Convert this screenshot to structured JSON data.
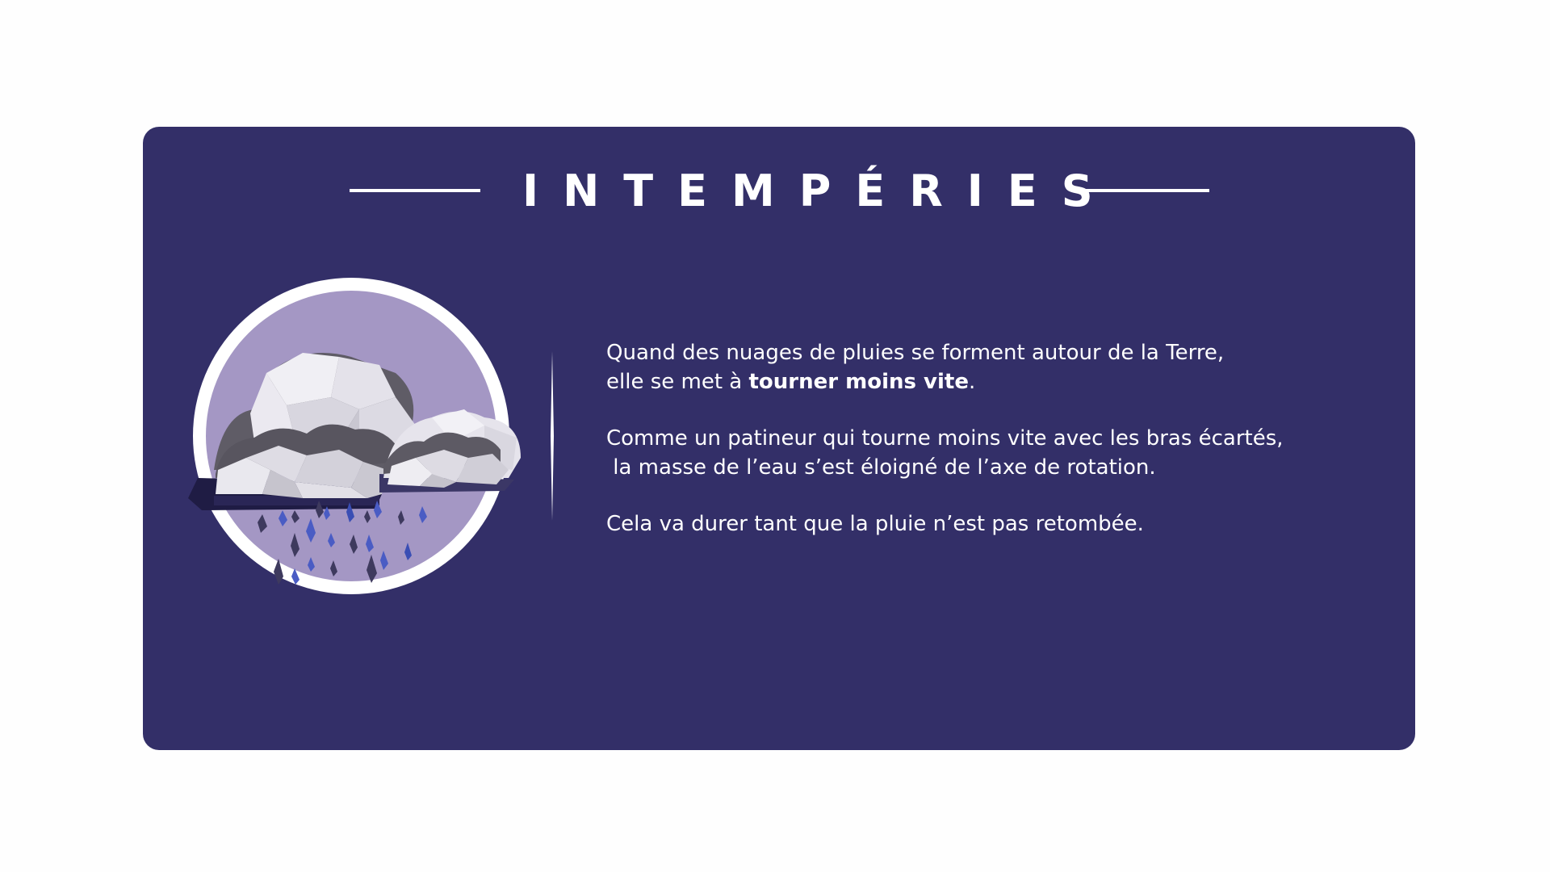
{
  "title": "INTEMPÉRIES",
  "paragraphs": {
    "p1_line1": "Quand des nuages de pluies se forment autour de la Terre,",
    "p1_line2_start": "elle se met à ",
    "p1_line2_bold": "tourner moins vite",
    "p1_line2_end": ".",
    "p2_line1": "Comme un patineur qui tourne moins vite avec les bras écartés,",
    "p2_line2": " la masse de l’eau s’est éloigné de l’axe de rotation.",
    "p3_line1": "Cela va durer tant que la pluie n’est pas retombée."
  },
  "illustration": {
    "icon": "rain-cloud-icon"
  },
  "colors": {
    "card_background": "#332f68",
    "circle_fill": "#a497c4",
    "text": "#ffffff",
    "raindrop": "#4a5cc4"
  }
}
